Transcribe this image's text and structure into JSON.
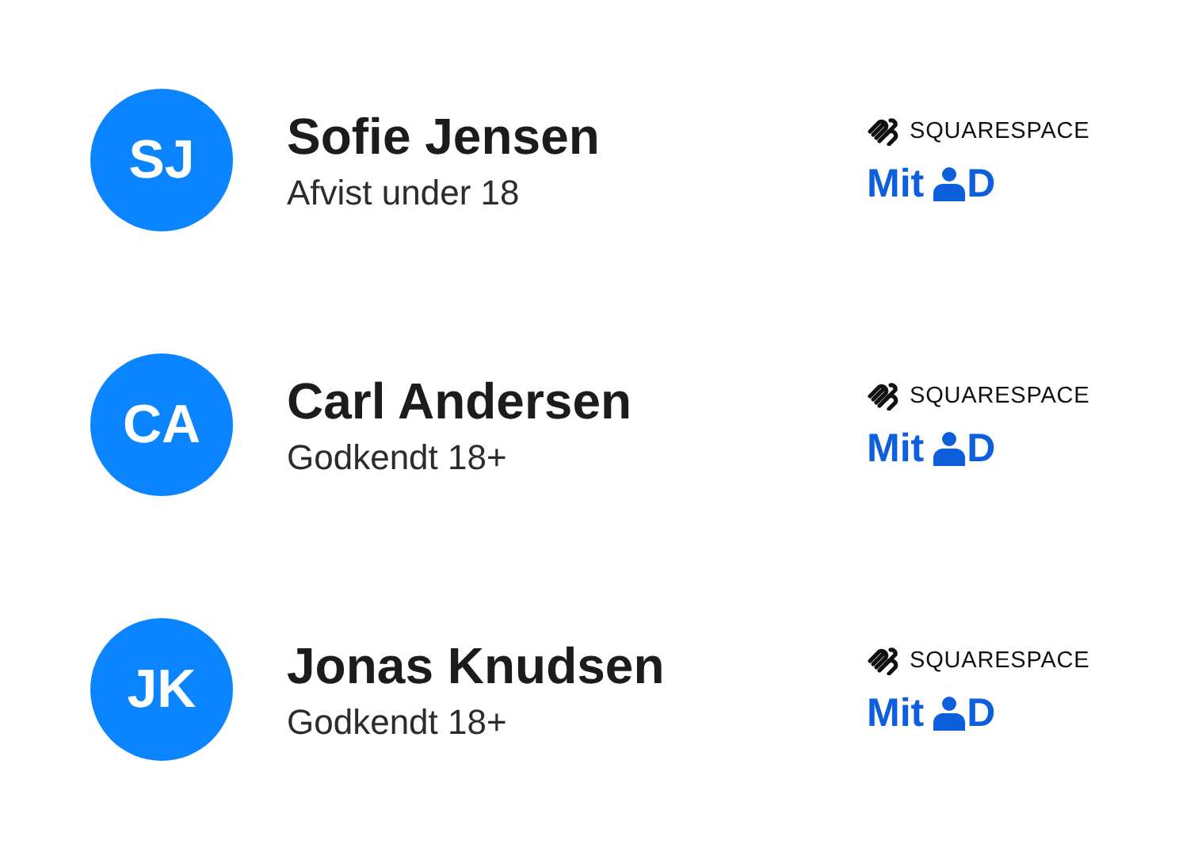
{
  "people": [
    {
      "initials": "SJ",
      "name": "Sofie Jensen",
      "status": "Afvist under 18",
      "provider": "SQUARESPACE",
      "id_brand": "Mit",
      "id_brand_end": "D"
    },
    {
      "initials": "CA",
      "name": "Carl Andersen",
      "status": "Godkendt 18+",
      "provider": "SQUARESPACE",
      "id_brand": "Mit",
      "id_brand_end": "D"
    },
    {
      "initials": "JK",
      "name": "Jonas Knudsen",
      "status": "Godkendt 18+",
      "provider": "SQUARESPACE",
      "id_brand": "Mit",
      "id_brand_end": "D"
    }
  ]
}
